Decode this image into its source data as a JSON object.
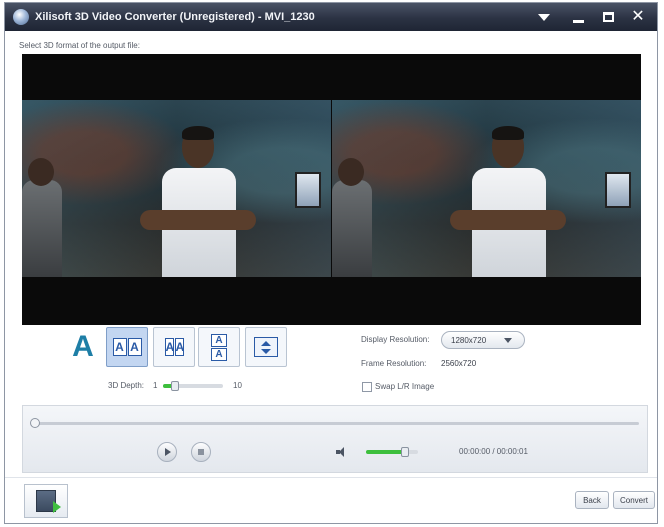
{
  "titlebar": {
    "title": "Xilisoft 3D Video Converter (Unregistered) - MVI_1230"
  },
  "instruction": "Select 3D format of the output file:",
  "modes": [
    {
      "name": "anaglyph",
      "label": "A",
      "active": false
    },
    {
      "name": "side-by-side",
      "label": "AA",
      "active": true
    },
    {
      "name": "side-by-side-half",
      "label": "AA",
      "active": false
    },
    {
      "name": "top-and-bottom",
      "label": "AA",
      "active": false
    },
    {
      "name": "swap",
      "label": "",
      "active": false
    }
  ],
  "depth": {
    "label": "3D Depth:",
    "min": "1",
    "max": "10",
    "value_fraction": 0.2
  },
  "display_resolution": {
    "label": "Display Resolution:",
    "value": "1280x720"
  },
  "frame_resolution": {
    "label": "Frame Resolution:",
    "value": "2560x720"
  },
  "swap_option": {
    "label": "Swap L/R Image",
    "checked": false
  },
  "playback": {
    "time": "00:00:00 / 00:00:01",
    "seek_fraction": 0.0,
    "volume_fraction": 0.75
  },
  "footer": {
    "back_label": "Back",
    "convert_label": "Convert"
  },
  "colors": {
    "titlebar": "#2b3243",
    "accent_green": "#3dbf3d",
    "active_mode": "#c3d6f1"
  }
}
